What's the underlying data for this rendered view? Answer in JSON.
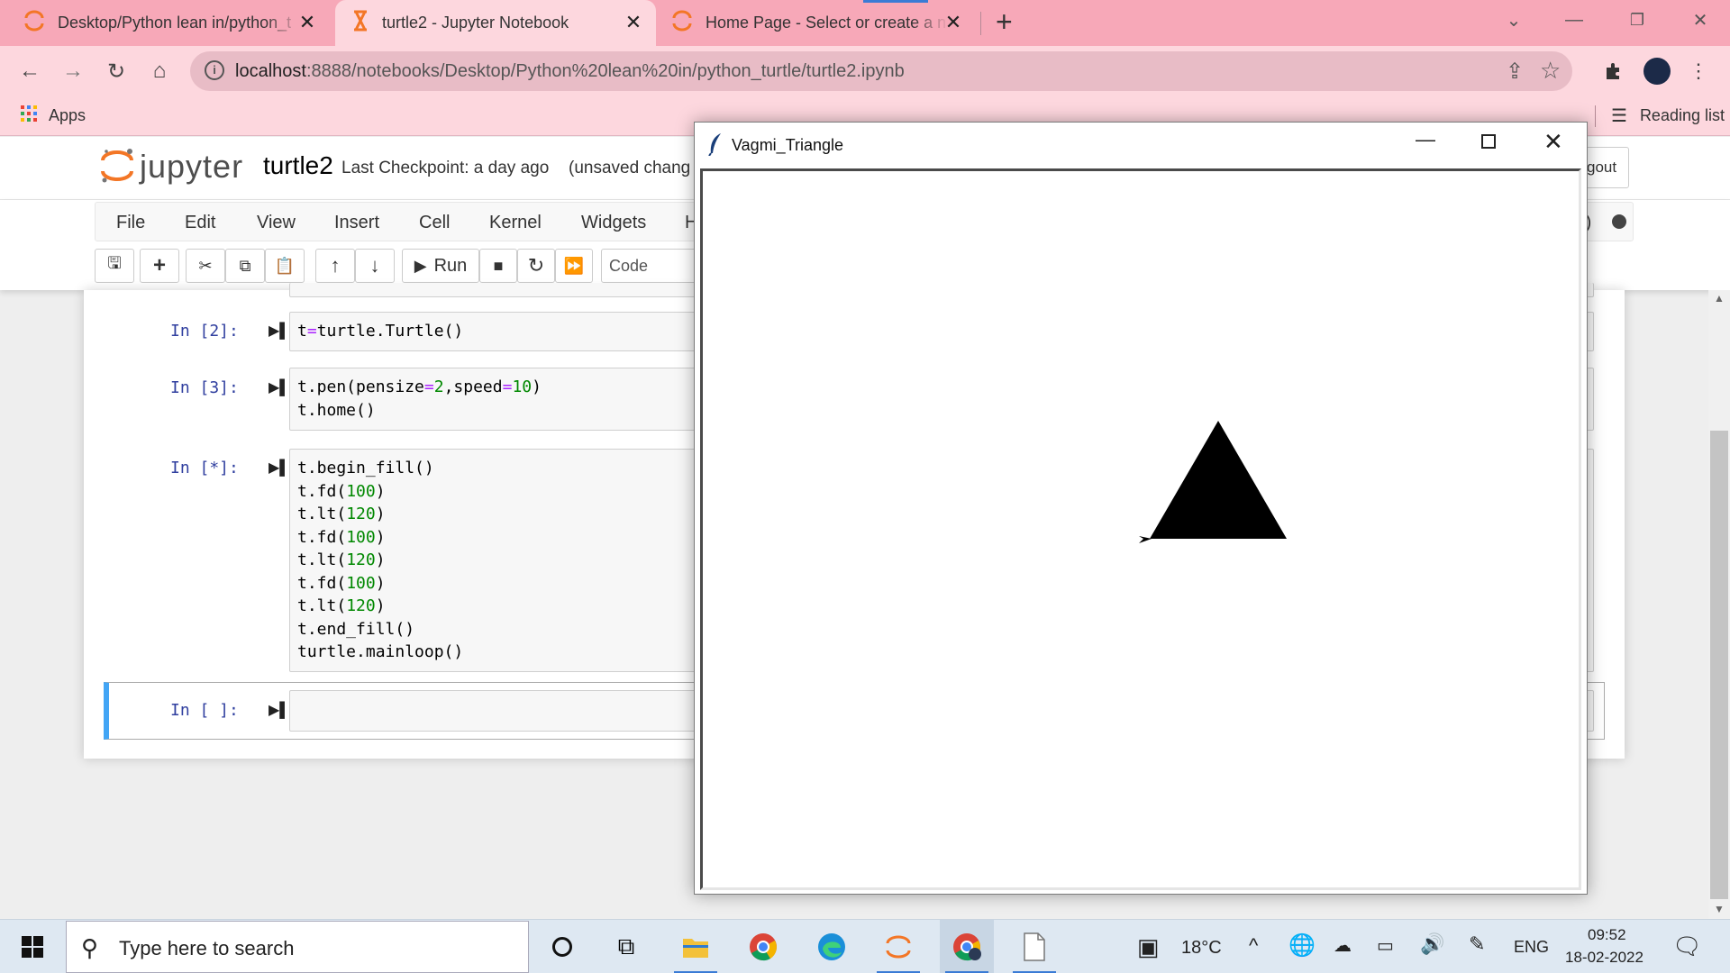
{
  "browser": {
    "tabs": [
      {
        "title": "Desktop/Python lean in/python_t",
        "icon": "jupyter-icon"
      },
      {
        "title": "turtle2 - Jupyter Notebook",
        "icon": "hourglass-icon"
      },
      {
        "title": "Home Page - Select or create a n",
        "icon": "jupyter-icon"
      }
    ],
    "new_tab_label": "+",
    "url_host": "localhost",
    "url_path": ":8888/notebooks/Desktop/Python%20lean%20in/python_turtle/turtle2.ipynb",
    "bookmarks": {
      "apps_label": "Apps",
      "reading_list_label": "Reading list"
    },
    "colors": {
      "tab_strip": "#f7a8b8",
      "toolbar": "#fdd7de",
      "omnibox": "#e8bcc6"
    }
  },
  "jupyter": {
    "logo_text": "jupyter",
    "notebook_name": "turtle2",
    "checkpoint": "Last Checkpoint: a day ago",
    "unsaved": "(unsaved chang",
    "logout_label": "gout",
    "kernel_label": "el)",
    "menu": [
      "File",
      "Edit",
      "View",
      "Insert",
      "Cell",
      "Kernel",
      "Widgets",
      "H"
    ],
    "run_label": "Run",
    "cell_type": "Code",
    "cells": [
      {
        "prompt": "In [2]:",
        "lines": [
          "t=turtle.Turtle()"
        ]
      },
      {
        "prompt": "In [3]:",
        "lines": [
          "t.pen(pensize=2,speed=10)",
          "t.home()"
        ]
      },
      {
        "prompt": "In [*]:",
        "lines": [
          "t.begin_fill()",
          "t.fd(100)",
          "t.lt(120)",
          "t.fd(100)",
          "t.lt(120)",
          "t.fd(100)",
          "t.lt(120)",
          "t.end_fill()",
          "turtle.mainloop()"
        ]
      },
      {
        "prompt": "In [ ]:",
        "lines": []
      }
    ],
    "colors": {
      "prompt": "#303f9f",
      "selected_cell_bar": "#42a5f5"
    }
  },
  "turtle_window": {
    "title": "Vagmi_Triangle",
    "shape_fill": "#000000"
  },
  "taskbar": {
    "search_placeholder": "Type here to search",
    "temperature": "18°C",
    "language": "ENG",
    "time": "09:52",
    "date": "18-02-2022",
    "color": "#dee8f2"
  }
}
